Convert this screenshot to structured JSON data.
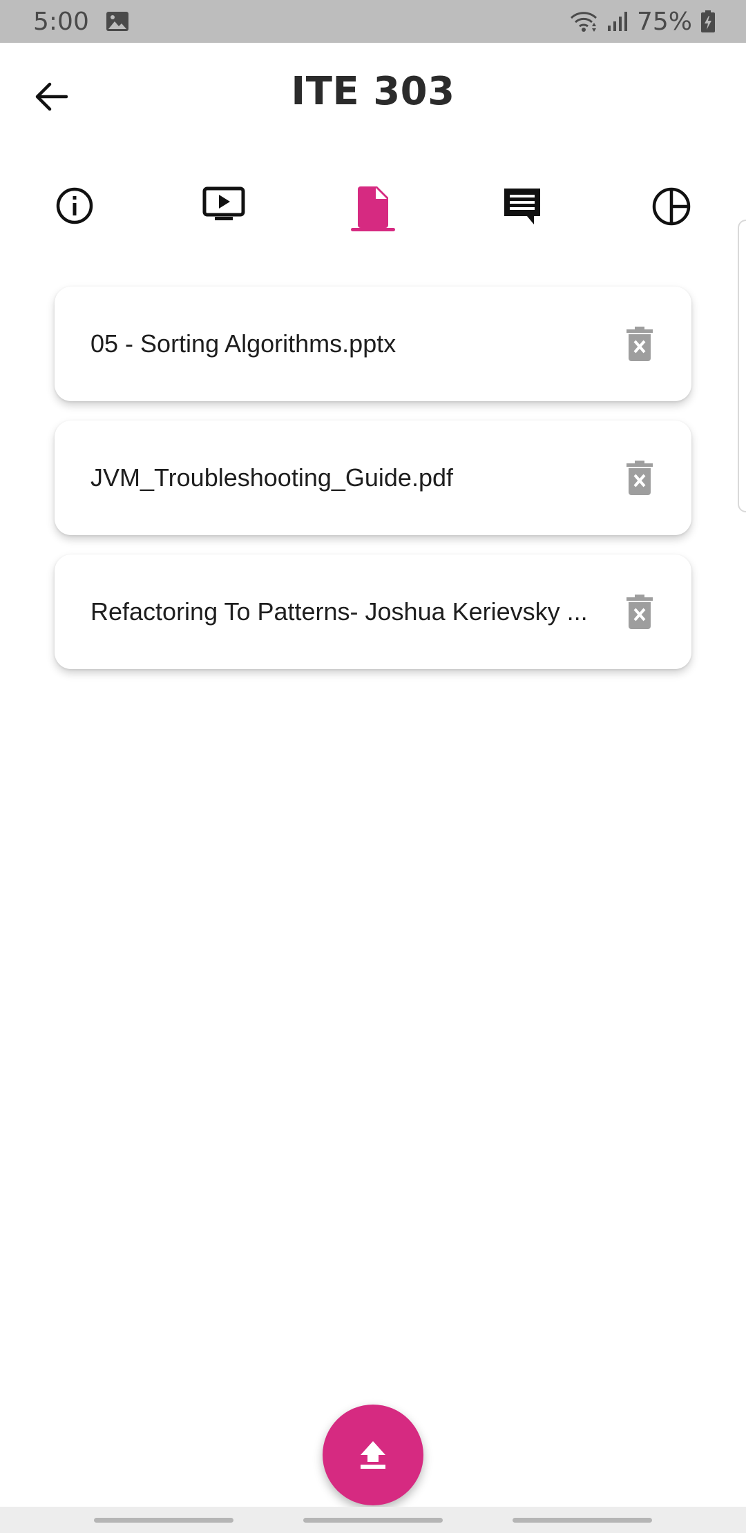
{
  "status_bar": {
    "time": "5:00",
    "battery": "75%",
    "icons": [
      "image-icon",
      "wifi-icon",
      "signal-icon",
      "battery-icon"
    ]
  },
  "header": {
    "title": "ITE 303",
    "back_icon": "arrow-left-icon"
  },
  "tabs": [
    {
      "icon": "info-icon",
      "active": false
    },
    {
      "icon": "video-icon",
      "active": false
    },
    {
      "icon": "file-icon",
      "active": true
    },
    {
      "icon": "chat-icon",
      "active": false
    },
    {
      "icon": "chart-icon",
      "active": false
    }
  ],
  "files": [
    {
      "name": "05 - Sorting Algorithms.pptx"
    },
    {
      "name": "JVM_Troubleshooting_Guide.pdf"
    },
    {
      "name": "Refactoring To Patterns- Joshua Kerievsky ..."
    }
  ],
  "fab": {
    "icon": "upload-icon"
  },
  "colors": {
    "accent": "#d62a81",
    "status_bar_bg": "#bdbdbd",
    "delete_icon": "#9e9e9e"
  }
}
